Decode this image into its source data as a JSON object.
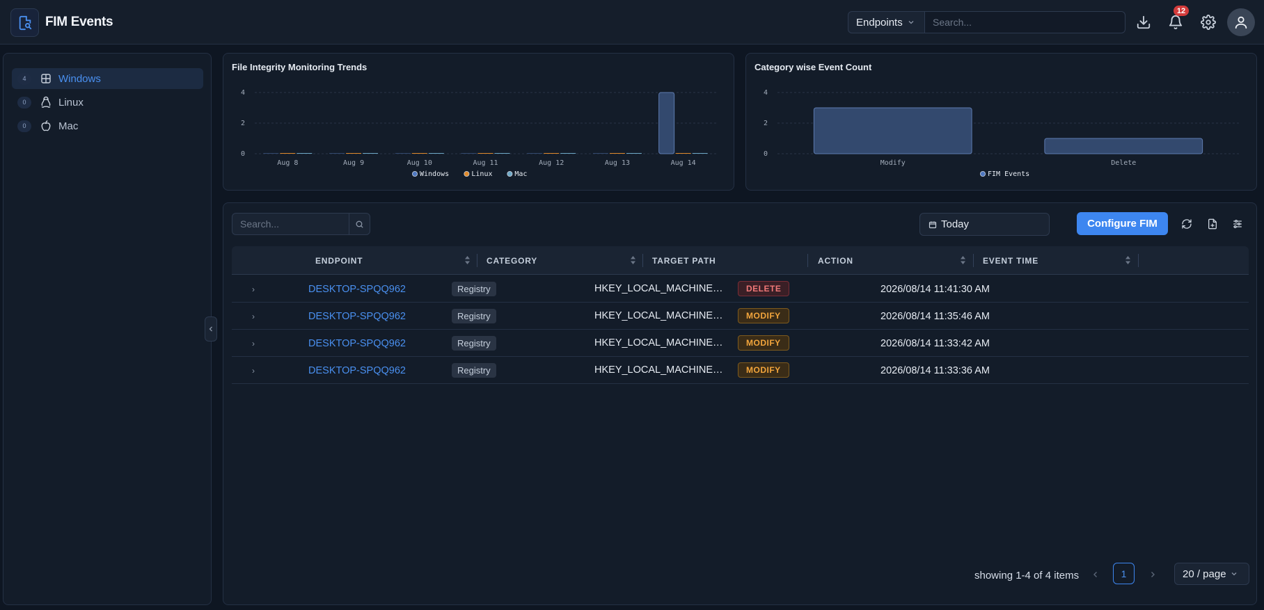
{
  "header": {
    "title": "FIM Events",
    "scope_label": "Endpoints",
    "search_placeholder": "Search...",
    "notification_count": "12"
  },
  "sidebar": {
    "items": [
      {
        "count": "4",
        "label": "Windows",
        "icon": "windows-icon",
        "active": true
      },
      {
        "count": "0",
        "label": "Linux",
        "icon": "linux-icon",
        "active": false
      },
      {
        "count": "0",
        "label": "Mac",
        "icon": "apple-icon",
        "active": false
      }
    ]
  },
  "charts": {
    "trends_title": "File Integrity Monitoring Trends",
    "category_title": "Category wise Event Count"
  },
  "chart_data": [
    {
      "type": "bar",
      "title": "File Integrity Monitoring Trends",
      "categories": [
        "Aug 8",
        "Aug 9",
        "Aug 10",
        "Aug 11",
        "Aug 12",
        "Aug 13",
        "Aug 14"
      ],
      "series": [
        {
          "name": "Windows",
          "values": [
            0,
            0,
            0,
            0,
            0,
            0,
            4
          ],
          "color": "#33496e"
        },
        {
          "name": "Linux",
          "values": [
            0,
            0,
            0,
            0,
            0,
            0,
            0
          ],
          "color": "#e08a2b"
        },
        {
          "name": "Mac",
          "values": [
            0,
            0,
            0,
            0,
            0,
            0,
            0
          ],
          "color": "#6fa9c7"
        }
      ],
      "yticks": [
        0,
        2,
        4
      ],
      "ylim": [
        0,
        4
      ],
      "grid": true,
      "legend": "bottom"
    },
    {
      "type": "bar",
      "title": "Category wise Event Count",
      "categories": [
        "Modify",
        "Delete"
      ],
      "series": [
        {
          "name": "FIM Events",
          "values": [
            3,
            1
          ],
          "color": "#33496e"
        }
      ],
      "yticks": [
        0,
        2,
        4
      ],
      "ylim": [
        0,
        4
      ],
      "grid": true,
      "legend": "bottom"
    }
  ],
  "table": {
    "search_placeholder": "Search...",
    "date_range": "Today",
    "configure_label": "Configure FIM",
    "columns": [
      "ENDPOINT",
      "CATEGORY",
      "TARGET PATH",
      "ACTION",
      "EVENT TIME"
    ],
    "rows": [
      {
        "endpoint": "DESKTOP-SPQQ962",
        "category": "Registry",
        "path": "HKEY_LOCAL_MACHINE\\SOFTWARE",
        "action": "DELETE",
        "time": "2026/08/14 11:41:30 AM"
      },
      {
        "endpoint": "DESKTOP-SPQQ962",
        "category": "Registry",
        "path": "HKEY_LOCAL_MACHINE\\SOFTWARE",
        "action": "MODIFY",
        "time": "2026/08/14 11:35:46 AM"
      },
      {
        "endpoint": "DESKTOP-SPQQ962",
        "category": "Registry",
        "path": "HKEY_LOCAL_MACHINE\\SOFTWARE",
        "action": "MODIFY",
        "time": "2026/08/14 11:33:42 AM"
      },
      {
        "endpoint": "DESKTOP-SPQQ962",
        "category": "Registry",
        "path": "HKEY_LOCAL_MACHINE\\SOFTWARE",
        "action": "MODIFY",
        "time": "2026/08/14 11:33:36 AM"
      }
    ],
    "showing_text": "showing 1-4 of 4 items",
    "current_page": "1",
    "page_size": "20 / page"
  },
  "colors": {
    "accent": "#3d86f0",
    "delete": "#f07878",
    "modify": "#f2a53c"
  }
}
